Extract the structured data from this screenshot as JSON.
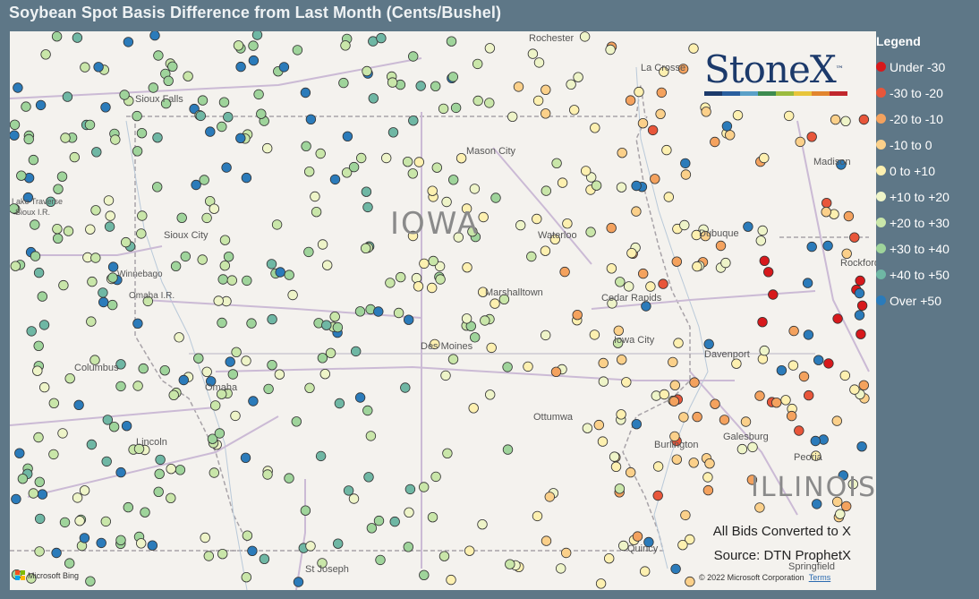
{
  "title": "Soybean Spot Basis Difference from Last Month (Cents/Bushel)",
  "legend": {
    "title": "Legend",
    "items": [
      {
        "label": "Under -30",
        "color": "#d7191c"
      },
      {
        "label": "-30 to -20",
        "color": "#e8563a"
      },
      {
        "label": "-20 to -10",
        "color": "#f4a25e"
      },
      {
        "label": "-10 to 0",
        "color": "#fbd08a"
      },
      {
        "label": "0 to +10",
        "color": "#fdf0b0"
      },
      {
        "label": "+10 to +20",
        "color": "#eef4c8"
      },
      {
        "label": "+20 to +30",
        "color": "#c9e6a9"
      },
      {
        "label": "+30 to +40",
        "color": "#9fd49b"
      },
      {
        "label": "+40 to +50",
        "color": "#6fb7a4"
      },
      {
        "label": "Over +50",
        "color": "#2b7bba"
      }
    ]
  },
  "logo": {
    "text": "StoneX",
    "tm": "™",
    "colors": [
      "#1c3a6b",
      "#2a5f9e",
      "#5aa0c8",
      "#3d8b4f",
      "#9bbb3e",
      "#e8c53a",
      "#e2852e",
      "#c1272d"
    ]
  },
  "notes": {
    "converted": "All Bids Converted to X",
    "source": "Source: DTN ProphetX"
  },
  "copyright": {
    "text": "© 2022 Microsoft Corporation",
    "terms": "Terms"
  },
  "bing": "Microsoft Bing",
  "map": {
    "states": [
      {
        "name": "IOWA",
        "id": "iowa"
      },
      {
        "name": "ILLINOIS",
        "id": "illinois"
      }
    ],
    "places": [
      {
        "id": "rochester",
        "name": "Rochester"
      },
      {
        "id": "lacrosse",
        "name": "La Crosse"
      },
      {
        "id": "siouxfalls",
        "name": "Sioux Falls"
      },
      {
        "id": "masoncity",
        "name": "Mason City"
      },
      {
        "id": "madison",
        "name": "Madison"
      },
      {
        "id": "lakentraverse",
        "name": "Lake Traverse"
      },
      {
        "id": "siouxir",
        "name": "Sioux I.R."
      },
      {
        "id": "siouxcity",
        "name": "Sioux City"
      },
      {
        "id": "waterloo",
        "name": "Waterloo"
      },
      {
        "id": "dubuque",
        "name": "Dubuque"
      },
      {
        "id": "rockford",
        "name": "Rockford"
      },
      {
        "id": "winnebago",
        "name": "Winnebago"
      },
      {
        "id": "omahair",
        "name": "Omaha I.R."
      },
      {
        "id": "marshalltown",
        "name": "Marshalltown"
      },
      {
        "id": "cedarrapids",
        "name": "Cedar Rapids"
      },
      {
        "id": "iowacity",
        "name": "Iowa City"
      },
      {
        "id": "desmoines",
        "name": "Des Moines"
      },
      {
        "id": "davenport",
        "name": "Davenport"
      },
      {
        "id": "columbus",
        "name": "Columbus"
      },
      {
        "id": "omaha",
        "name": "Omaha"
      },
      {
        "id": "ottumwa",
        "name": "Ottumwa"
      },
      {
        "id": "galesburg",
        "name": "Galesburg"
      },
      {
        "id": "lincoln",
        "name": "Lincoln"
      },
      {
        "id": "burlington",
        "name": "Burlington"
      },
      {
        "id": "peoria",
        "name": "Peoria"
      },
      {
        "id": "quincy",
        "name": "Quincy"
      },
      {
        "id": "springfield",
        "name": "Springfield"
      },
      {
        "id": "stjoseph",
        "name": "St Joseph"
      }
    ]
  }
}
